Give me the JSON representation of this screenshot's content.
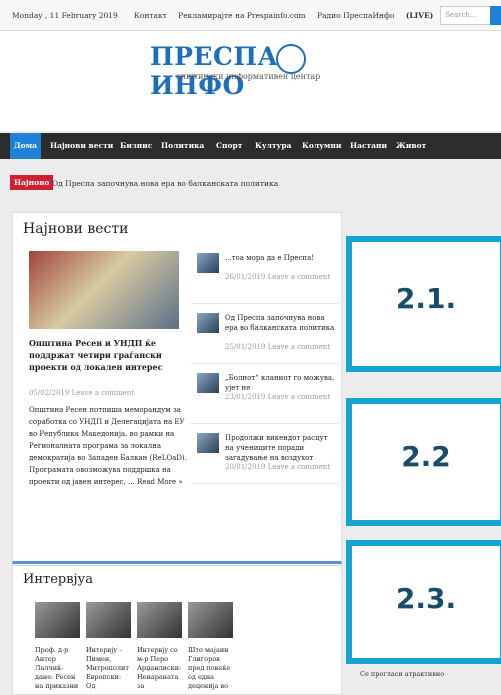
{
  "topbar": {
    "date": "Monday , 11 February 2019",
    "links": [
      "Контакт",
      "Рекламирајте на Prespainfo.com",
      "Радио ПреспаИнфо"
    ],
    "live": "(LIVE)",
    "search_placeholder": "Search..."
  },
  "logo": {
    "title": "ПРЕСПА ИНФО",
    "subtitle": "општински информативен центар"
  },
  "nav": [
    "Дома",
    "Најнови вести",
    "Бизнис",
    "Политика",
    "Спорт",
    "Култура",
    "Колумни",
    "Настани",
    "Живот"
  ],
  "ticker": {
    "badge": "Најново",
    "text": "Од Преспа започнува нова ера во балканската политика"
  },
  "latest": {
    "title": "Најнови вести",
    "main": {
      "title": "Општина Ресен и УНДП ќе поддржат четири граѓански проекти од локален интерес",
      "meta": "05/02/2019   Leave a comment",
      "body": "Општина Ресен потпиша меморандум за соработка со УНДП и Делегацијата на ЕУ во Република Македонија, во рамки на Регионалната програма за локална демократија во Западен Балкан (ReLOaD). Програмата овозможува поддршка на проекти од јавен интерес, ... Read More »"
    },
    "side": [
      {
        "title": "...тоа мора да е Преспа!",
        "meta": "26/01/2019 Leave a comment"
      },
      {
        "title": "Од Преспа започнува нова ера во балканската политика",
        "meta": "25/01/2019 Leave a comment"
      },
      {
        "title": "„Болнот“ кланиот го можува, ујет не",
        "meta": "23/01/2019 Leave a comment"
      },
      {
        "title": "Продолжи викендот расцут на учениците поради загадување на воздухот",
        "meta": "20/01/2019 Leave a comment"
      }
    ]
  },
  "interview": {
    "title": "Интервјуа",
    "items": [
      "Проф. д-р Антер Лалчиќ-дане: Ресен на приказни",
      "Интервју – Пимен, Митрополит Европски: Од",
      "Интервју со м-р Перо Арџанлиски: Ненараната за",
      "Што мајаин Глигоров пред повеќе од една деценија во"
    ]
  },
  "ads": [
    "2.1.",
    "2.2",
    "2.3."
  ],
  "right_bottom": "Се прогласи атрактивно",
  "colors": {
    "accent": "#1e82d7",
    "ad_border": "#14a3d4",
    "ticker": "#d01f2f"
  }
}
